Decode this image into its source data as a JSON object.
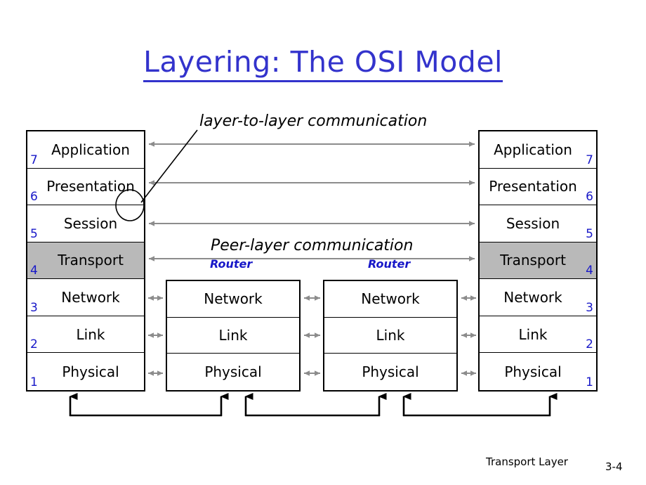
{
  "title": {
    "text": "Layering: The OSI Model",
    "color": "#3333cc"
  },
  "annotations": {
    "layer_to_layer": "layer-to-layer communication",
    "peer_layer": "Peer-layer communication",
    "router_1": "Router",
    "router_2": "Router",
    "callout_shape": "ellipse-callout"
  },
  "colors": {
    "title_blue": "#3333cc",
    "number_blue": "#1818c8",
    "shaded_layer": "#b9b9b9",
    "arrow_gray": "#8c8c8c",
    "box_border": "#000000"
  },
  "left_stack": {
    "name": "end-system-left",
    "layers": [
      {
        "num": "7",
        "label": "Application",
        "shaded": false
      },
      {
        "num": "6",
        "label": "Presentation",
        "shaded": false
      },
      {
        "num": "5",
        "label": "Session",
        "shaded": false
      },
      {
        "num": "4",
        "label": "Transport",
        "shaded": true
      },
      {
        "num": "3",
        "label": "Network",
        "shaded": false
      },
      {
        "num": "2",
        "label": "Link",
        "shaded": false
      },
      {
        "num": "1",
        "label": "Physical",
        "shaded": false
      }
    ]
  },
  "right_stack": {
    "name": "end-system-right",
    "layers": [
      {
        "num": "7",
        "label": "Application",
        "shaded": false
      },
      {
        "num": "6",
        "label": "Presentation",
        "shaded": false
      },
      {
        "num": "5",
        "label": "Session",
        "shaded": false
      },
      {
        "num": "4",
        "label": "Transport",
        "shaded": true
      },
      {
        "num": "3",
        "label": "Network",
        "shaded": false
      },
      {
        "num": "2",
        "label": "Link",
        "shaded": false
      },
      {
        "num": "1",
        "label": "Physical",
        "shaded": false
      }
    ]
  },
  "router_1_stack": {
    "name": "router-left",
    "layers": [
      {
        "label": "Network"
      },
      {
        "label": "Link"
      },
      {
        "label": "Physical"
      }
    ]
  },
  "router_2_stack": {
    "name": "router-right",
    "layers": [
      {
        "label": "Network"
      },
      {
        "label": "Link"
      },
      {
        "label": "Physical"
      }
    ]
  },
  "footer": {
    "title": "Transport Layer",
    "page": "3-4"
  }
}
